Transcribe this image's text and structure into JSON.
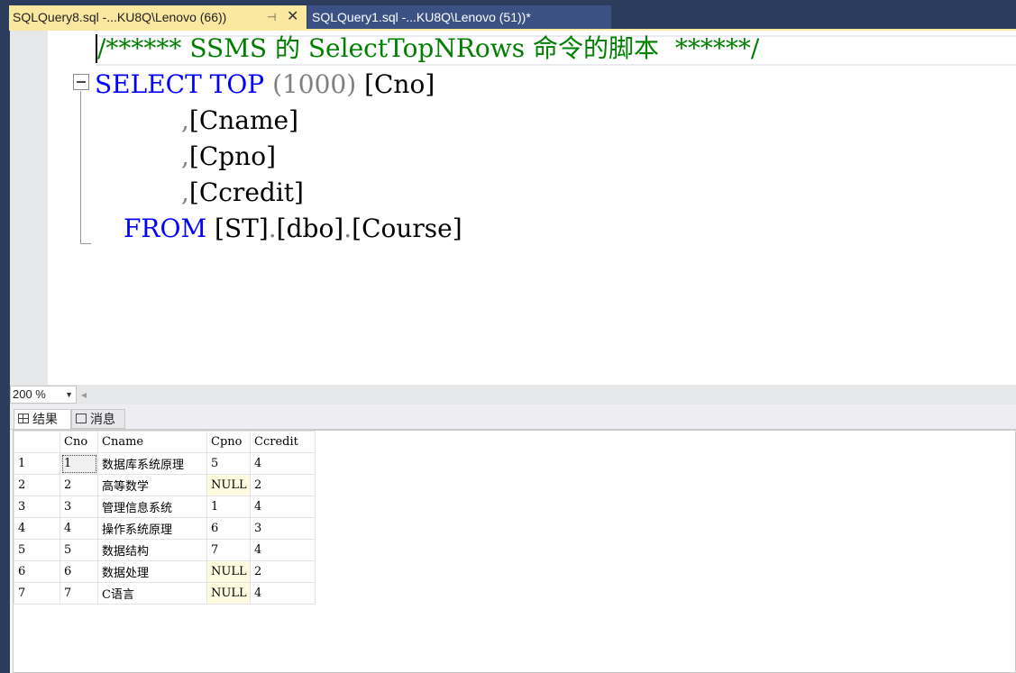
{
  "tabs": {
    "active": {
      "title": "SQLQuery8.sql -...KU8Q\\Lenovo (66))",
      "pin_icon": "pin-icon",
      "close_icon": "close-icon"
    },
    "inactive": {
      "title": "SQLQuery1.sql -...KU8Q\\Lenovo (51))*"
    }
  },
  "editor": {
    "comment": "/****** SSMS 的 SelectTopNRows 命令的脚本  ******/",
    "line1": {
      "kw1": "SELECT",
      "kw2": "TOP",
      "paren": "(1000)",
      "col": "[Cno]"
    },
    "line2": {
      "comma": ",",
      "col": "[Cname]"
    },
    "line3": {
      "comma": ",",
      "col": "[Cpno]"
    },
    "line4": {
      "comma": ",",
      "col": "[Ccredit]"
    },
    "line5": {
      "kw": "FROM",
      "p1": "[ST]",
      "dot1": ".",
      "p2": "[dbo]",
      "dot2": ".",
      "p3": "[Course]"
    }
  },
  "zoom": {
    "value": "200 %"
  },
  "results": {
    "tab_results": "结果",
    "tab_messages": "消息",
    "columns": [
      "Cno",
      "Cname",
      "Cpno",
      "Ccredit"
    ],
    "rows": [
      {
        "n": "1",
        "Cno": "1",
        "Cname": "数据库系统原理",
        "Cpno": "5",
        "Ccredit": "4"
      },
      {
        "n": "2",
        "Cno": "2",
        "Cname": "高等数学",
        "Cpno": "NULL",
        "Ccredit": "2"
      },
      {
        "n": "3",
        "Cno": "3",
        "Cname": "管理信息系统",
        "Cpno": "1",
        "Ccredit": "4"
      },
      {
        "n": "4",
        "Cno": "4",
        "Cname": "操作系统原理",
        "Cpno": "6",
        "Ccredit": "3"
      },
      {
        "n": "5",
        "Cno": "5",
        "Cname": "数据结构",
        "Cpno": "7",
        "Ccredit": "4"
      },
      {
        "n": "6",
        "Cno": "6",
        "Cname": "数据处理",
        "Cpno": "NULL",
        "Ccredit": "2"
      },
      {
        "n": "7",
        "Cno": "7",
        "Cname": "C语言",
        "Cpno": "NULL",
        "Ccredit": "4"
      }
    ]
  },
  "colors": {
    "chrome": "#2b3c5c",
    "active_tab": "#fbe8a0",
    "keyword": "#0000ff",
    "comment": "#008000",
    "null_cell": "#fffbe0"
  }
}
